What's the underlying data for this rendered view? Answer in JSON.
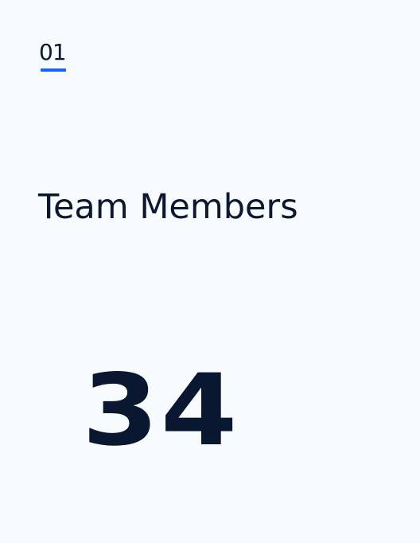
{
  "card": {
    "index": "01",
    "title": "Team Members",
    "value": "34",
    "colors": {
      "background": "#f7fbfe",
      "text": "#0c1830",
      "accent": "#1463ff"
    }
  }
}
